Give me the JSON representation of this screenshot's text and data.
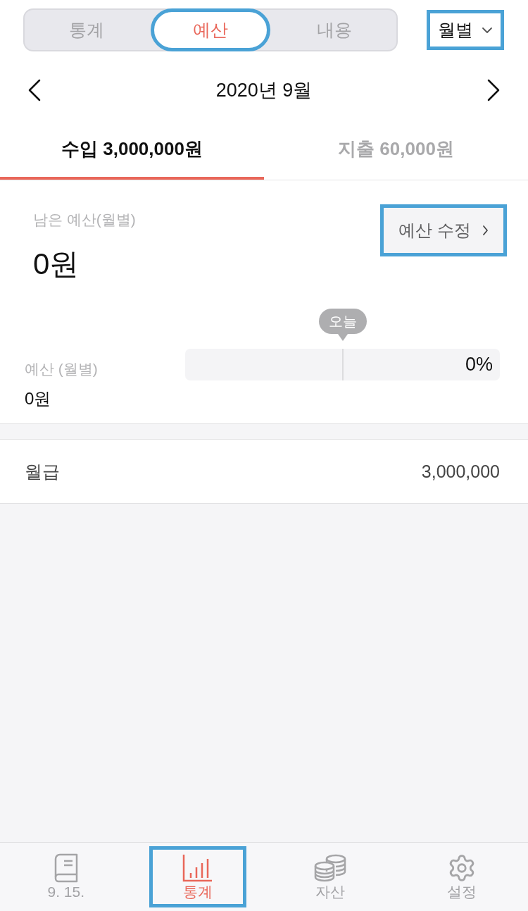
{
  "segments": [
    {
      "label": "통계",
      "selected": false,
      "highlighted": false
    },
    {
      "label": "예산",
      "selected": true,
      "highlighted": true
    },
    {
      "label": "내용",
      "selected": false,
      "highlighted": false
    }
  ],
  "period_dropdown": {
    "value": "월별",
    "highlighted": true
  },
  "month_nav": {
    "title": "2020년 9월"
  },
  "summary_tabs": [
    {
      "label": "수입 3,000,000원",
      "selected": true
    },
    {
      "label": "지출 60,000원",
      "selected": false
    }
  ],
  "budget_card": {
    "remaining_label": "남은 예산(월별)",
    "remaining_amount": "0원",
    "edit_button": {
      "label": "예산 수정",
      "highlighted": true
    },
    "today_marker": {
      "label": "오늘",
      "level": 0.5
    },
    "budget_label": "예산 (월별)",
    "budget_amount": "0원",
    "progress": {
      "reading": "0%"
    }
  },
  "entries": [
    {
      "name": "월급",
      "amount": "3,000,000"
    }
  ],
  "bottom_nav": [
    {
      "label": "9. 15.",
      "selected": false,
      "highlighted": false
    },
    {
      "label": "통계",
      "selected": true,
      "highlighted": true
    },
    {
      "label": "자산",
      "selected": false,
      "highlighted": false
    },
    {
      "label": "설정",
      "selected": false,
      "highlighted": false
    }
  ]
}
